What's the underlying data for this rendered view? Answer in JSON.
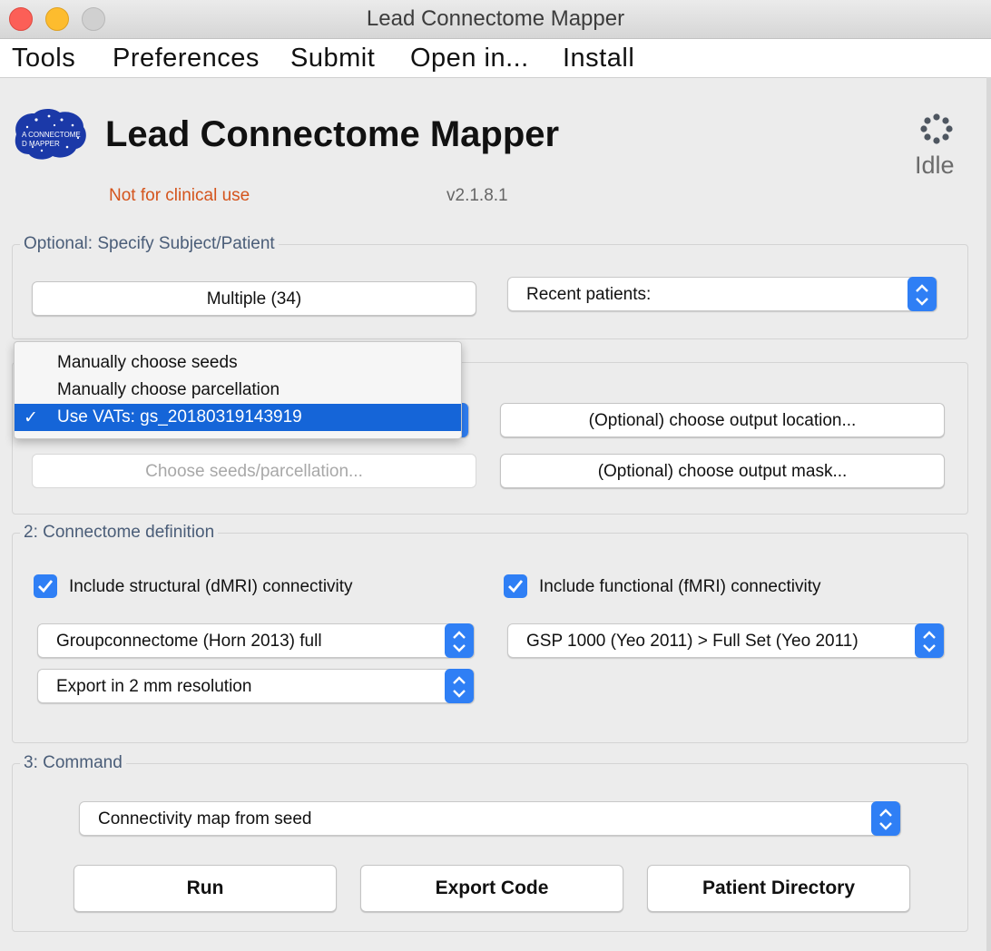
{
  "window": {
    "title": "Lead Connectome Mapper"
  },
  "menubar": {
    "items": [
      "Tools",
      "Preferences",
      "Submit",
      "Open in...",
      "Install"
    ]
  },
  "header": {
    "logo_text_1": "A CONNECTOME",
    "logo_text_2": "D MAPPER",
    "title": "Lead Connectome Mapper",
    "disclaimer": "Not for clinical use",
    "version": "v2.1.8.1",
    "status": "Idle"
  },
  "subject_panel": {
    "title": "Optional: Specify Subject/Patient",
    "patients_button": "Multiple (34)",
    "recent_select": "Recent patients:"
  },
  "seed_panel": {
    "choose_button": "Choose seeds/parcellation...",
    "output_location_button": "(Optional) choose output location...",
    "output_mask_button": "(Optional) choose output mask...",
    "dropdown": {
      "options": [
        "Manually choose seeds",
        "Manually choose parcellation",
        "Use VATs: gs_20180319143919"
      ],
      "selected_index": 2
    }
  },
  "connectome_panel": {
    "title": "2: Connectome definition",
    "structural_checkbox": "Include structural (dMRI) connectivity",
    "structural_checked": true,
    "functional_checkbox": "Include functional (fMRI) connectivity",
    "functional_checked": true,
    "structural_select": "Groupconnectome (Horn 2013) full",
    "functional_select": "GSP 1000 (Yeo 2011) > Full Set (Yeo 2011)",
    "resolution_select": "Export in 2 mm resolution"
  },
  "command_panel": {
    "title": "3: Command",
    "command_select": "Connectivity map from seed",
    "run_button": "Run",
    "export_button": "Export Code",
    "patient_dir_button": "Patient Directory"
  },
  "colors": {
    "accent": "#2f7ff5",
    "disclaimer": "#d4541c",
    "selection": "#1565d8"
  }
}
